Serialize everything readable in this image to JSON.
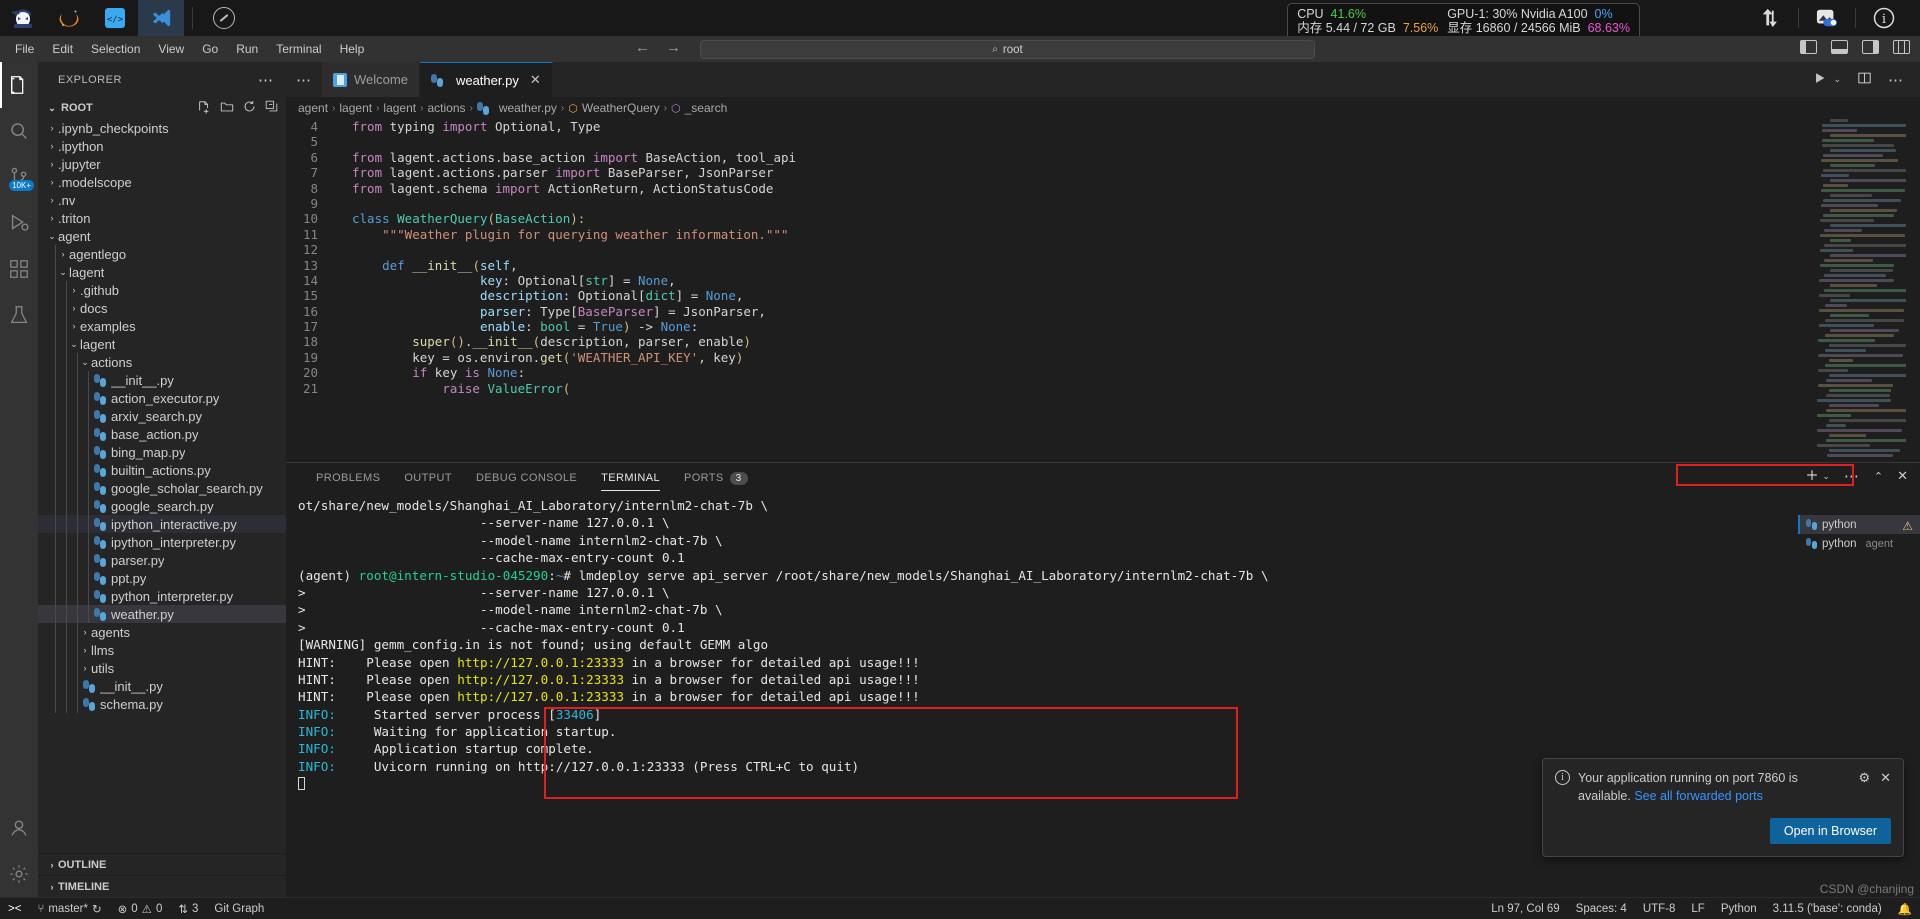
{
  "osbar": {
    "icons": [
      {
        "name": "ninja-app-icon",
        "glyph": "🥷"
      },
      {
        "name": "orange-crescent-icon",
        "glyph": "◠"
      },
      {
        "name": "code-brackets-icon",
        "glyph": "</>"
      },
      {
        "name": "vscode-icon",
        "glyph": "X"
      }
    ],
    "compass_label": "compass-icon",
    "sysmon": {
      "cpu_label": "CPU",
      "cpu_value": "41.6%",
      "mem_label": "内存",
      "mem_value": "5.44 / 72 GB",
      "mem_percent": "7.56%",
      "gpu_label": "GPU-1: 30% Nvidia A100",
      "gpu_value": "0%",
      "vram_label": "显存",
      "vram_value": "16860 / 24566 MiB",
      "vram_percent": "68.63%"
    }
  },
  "menubar": {
    "items": [
      "File",
      "Edit",
      "Selection",
      "View",
      "Go",
      "Run",
      "Terminal",
      "Help"
    ],
    "back_glyph": "←",
    "forward_glyph": "→",
    "search_text": "root",
    "search_icon": "⌕"
  },
  "activitybar": {
    "items": [
      {
        "name": "explorer",
        "glyph": "❐",
        "badge": ""
      },
      {
        "name": "search",
        "glyph": "⌕",
        "badge": ""
      },
      {
        "name": "source-control",
        "glyph": "⑂",
        "badge": "10K+"
      },
      {
        "name": "run-and-debug",
        "glyph": "▷",
        "badge": ""
      },
      {
        "name": "extensions",
        "glyph": "⧉",
        "badge": ""
      },
      {
        "name": "testing",
        "glyph": "⚗",
        "badge": ""
      }
    ],
    "bottom": [
      {
        "name": "accounts",
        "glyph": "☻"
      },
      {
        "name": "manage-settings",
        "glyph": "⚙"
      }
    ]
  },
  "sidebar": {
    "title": "EXPLORER",
    "more_glyph": "⋯",
    "root": {
      "label": "ROOT",
      "actions": [
        "new-file",
        "new-folder",
        "refresh",
        "collapse-all"
      ]
    },
    "tree": [
      {
        "label": ".ipynb_checkpoints",
        "type": "folder",
        "open": false,
        "depth": 1
      },
      {
        "label": ".ipython",
        "type": "folder",
        "open": false,
        "depth": 1
      },
      {
        "label": ".jupyter",
        "type": "folder",
        "open": false,
        "depth": 1
      },
      {
        "label": ".modelscope",
        "type": "folder",
        "open": false,
        "depth": 1
      },
      {
        "label": ".nv",
        "type": "folder",
        "open": false,
        "depth": 1
      },
      {
        "label": ".triton",
        "type": "folder",
        "open": false,
        "depth": 1
      },
      {
        "label": "agent",
        "type": "folder",
        "open": true,
        "depth": 1
      },
      {
        "label": "agentlego",
        "type": "folder",
        "open": false,
        "depth": 2
      },
      {
        "label": "lagent",
        "type": "folder",
        "open": true,
        "depth": 2
      },
      {
        "label": ".github",
        "type": "folder",
        "open": false,
        "depth": 3
      },
      {
        "label": "docs",
        "type": "folder",
        "open": false,
        "depth": 3
      },
      {
        "label": "examples",
        "type": "folder",
        "open": false,
        "depth": 3
      },
      {
        "label": "lagent",
        "type": "folder",
        "open": true,
        "depth": 3
      },
      {
        "label": "actions",
        "type": "folder",
        "open": true,
        "depth": 4
      },
      {
        "label": "__init__.py",
        "type": "py",
        "depth": 5
      },
      {
        "label": "action_executor.py",
        "type": "py",
        "depth": 5
      },
      {
        "label": "arxiv_search.py",
        "type": "py",
        "depth": 5
      },
      {
        "label": "base_action.py",
        "type": "py",
        "depth": 5
      },
      {
        "label": "bing_map.py",
        "type": "py",
        "depth": 5
      },
      {
        "label": "builtin_actions.py",
        "type": "py",
        "depth": 5
      },
      {
        "label": "google_scholar_search.py",
        "type": "py",
        "depth": 5
      },
      {
        "label": "google_search.py",
        "type": "py",
        "depth": 5
      },
      {
        "label": "ipython_interactive.py",
        "type": "py",
        "depth": 5,
        "hover": true
      },
      {
        "label": "ipython_interpreter.py",
        "type": "py",
        "depth": 5
      },
      {
        "label": "parser.py",
        "type": "py",
        "depth": 5
      },
      {
        "label": "ppt.py",
        "type": "py",
        "depth": 5
      },
      {
        "label": "python_interpreter.py",
        "type": "py",
        "depth": 5
      },
      {
        "label": "weather.py",
        "type": "py",
        "depth": 5,
        "selected": true
      },
      {
        "label": "agents",
        "type": "folder",
        "open": false,
        "depth": 4
      },
      {
        "label": "llms",
        "type": "folder",
        "open": false,
        "depth": 4
      },
      {
        "label": "utils",
        "type": "folder",
        "open": false,
        "depth": 4
      },
      {
        "label": "__init__.py",
        "type": "py",
        "depth": 4
      },
      {
        "label": "schema.py",
        "type": "py",
        "depth": 4
      }
    ],
    "footers": [
      {
        "label": "OUTLINE"
      },
      {
        "label": "TIMELINE"
      }
    ]
  },
  "editor": {
    "tabs": [
      {
        "label": "Welcome",
        "icon": "welcome-icon",
        "active": false
      },
      {
        "label": "weather.py",
        "icon": "python-icon",
        "active": true,
        "close": "✕"
      }
    ],
    "tab_actions": [
      "run-file",
      "split-editor",
      "more-actions"
    ],
    "breadcrumb": [
      "agent",
      "lagent",
      "lagent",
      "actions",
      "weather.py",
      "WeatherQuery",
      "_search"
    ],
    "lines": [
      {
        "n": 4,
        "tokens": [
          {
            "t": "from ",
            "c": "k-kw"
          },
          {
            "t": "typing ",
            "c": "k-plain"
          },
          {
            "t": "import ",
            "c": "k-kw"
          },
          {
            "t": "Optional, Type",
            "c": "k-plain"
          }
        ]
      },
      {
        "n": 5,
        "tokens": []
      },
      {
        "n": 6,
        "tokens": [
          {
            "t": "from ",
            "c": "k-kw"
          },
          {
            "t": "lagent.actions.base_action ",
            "c": "k-plain"
          },
          {
            "t": "import ",
            "c": "k-kw"
          },
          {
            "t": "BaseAction, tool_api",
            "c": "k-plain"
          }
        ]
      },
      {
        "n": 7,
        "tokens": [
          {
            "t": "from ",
            "c": "k-kw"
          },
          {
            "t": "lagent.actions.parser ",
            "c": "k-plain"
          },
          {
            "t": "import ",
            "c": "k-kw"
          },
          {
            "t": "BaseParser, JsonParser",
            "c": "k-plain"
          }
        ]
      },
      {
        "n": 8,
        "tokens": [
          {
            "t": "from ",
            "c": "k-kw"
          },
          {
            "t": "lagent.schema ",
            "c": "k-plain"
          },
          {
            "t": "import ",
            "c": "k-kw"
          },
          {
            "t": "ActionReturn, ActionStatusCode",
            "c": "k-plain"
          }
        ]
      },
      {
        "n": 9,
        "tokens": []
      },
      {
        "n": 10,
        "tokens": [
          {
            "t": "class ",
            "c": "k-ctl"
          },
          {
            "t": "WeatherQuery",
            "c": "k-cls"
          },
          {
            "t": "(",
            "c": "k-orange"
          },
          {
            "t": "BaseAction",
            "c": "k-cls"
          },
          {
            "t": "):",
            "c": "k-orange"
          }
        ]
      },
      {
        "n": 11,
        "tokens": [
          {
            "t": "    \"\"\"Weather plugin for querying weather information.\"\"\"",
            "c": "k-doc"
          }
        ]
      },
      {
        "n": 12,
        "tokens": []
      },
      {
        "n": 13,
        "tokens": [
          {
            "t": "    ",
            "c": "k-plain"
          },
          {
            "t": "def ",
            "c": "k-ctl"
          },
          {
            "t": "__init__",
            "c": "k-fn"
          },
          {
            "t": "(",
            "c": "k-orange"
          },
          {
            "t": "self",
            "c": "k-var"
          },
          {
            "t": ",",
            "c": "k-plain"
          }
        ]
      },
      {
        "n": 14,
        "tokens": [
          {
            "t": "                 ",
            "c": "k-plain"
          },
          {
            "t": "key",
            "c": "k-var"
          },
          {
            "t": ": Optional[",
            "c": "k-plain"
          },
          {
            "t": "str",
            "c": "k-cls"
          },
          {
            "t": "] = ",
            "c": "k-plain"
          },
          {
            "t": "None",
            "c": "k-ctl"
          },
          {
            "t": ",",
            "c": "k-plain"
          }
        ]
      },
      {
        "n": 15,
        "tokens": [
          {
            "t": "                 ",
            "c": "k-plain"
          },
          {
            "t": "description",
            "c": "k-var"
          },
          {
            "t": ": Optional[",
            "c": "k-plain"
          },
          {
            "t": "dict",
            "c": "k-cls"
          },
          {
            "t": "] = ",
            "c": "k-plain"
          },
          {
            "t": "None",
            "c": "k-ctl"
          },
          {
            "t": ",",
            "c": "k-plain"
          }
        ]
      },
      {
        "n": 16,
        "tokens": [
          {
            "t": "                 ",
            "c": "k-plain"
          },
          {
            "t": "parser",
            "c": "k-var"
          },
          {
            "t": ": Type[",
            "c": "k-plain"
          },
          {
            "t": "BaseParser",
            "c": "k-pink"
          },
          {
            "t": "] = JsonParser,",
            "c": "k-plain"
          }
        ]
      },
      {
        "n": 17,
        "tokens": [
          {
            "t": "                 ",
            "c": "k-plain"
          },
          {
            "t": "enable",
            "c": "k-var"
          },
          {
            "t": ": ",
            "c": "k-plain"
          },
          {
            "t": "bool",
            "c": "k-cls"
          },
          {
            "t": " = ",
            "c": "k-plain"
          },
          {
            "t": "True",
            "c": "k-ctl"
          },
          {
            "t": ")",
            "c": "k-orange"
          },
          {
            "t": " -> ",
            "c": "k-plain"
          },
          {
            "t": "None",
            "c": "k-ctl"
          },
          {
            "t": ":",
            "c": "k-plain"
          }
        ]
      },
      {
        "n": 18,
        "tokens": [
          {
            "t": "        ",
            "c": "k-plain"
          },
          {
            "t": "super",
            "c": "k-fn"
          },
          {
            "t": "()",
            "c": "k-orange"
          },
          {
            "t": ".",
            "c": "k-plain"
          },
          {
            "t": "__init__",
            "c": "k-fn"
          },
          {
            "t": "(",
            "c": "k-orange"
          },
          {
            "t": "description, parser, enable",
            "c": "k-plain"
          },
          {
            "t": ")",
            "c": "k-orange"
          }
        ]
      },
      {
        "n": 19,
        "tokens": [
          {
            "t": "        key = os.environ.",
            "c": "k-plain"
          },
          {
            "t": "get",
            "c": "k-fn"
          },
          {
            "t": "(",
            "c": "k-orange"
          },
          {
            "t": "'WEATHER_API_KEY'",
            "c": "k-str"
          },
          {
            "t": ", key",
            "c": "k-plain"
          },
          {
            "t": ")",
            "c": "k-orange"
          }
        ]
      },
      {
        "n": 20,
        "tokens": [
          {
            "t": "        ",
            "c": "k-plain"
          },
          {
            "t": "if ",
            "c": "k-pink"
          },
          {
            "t": "key ",
            "c": "k-plain"
          },
          {
            "t": "is ",
            "c": "k-pink"
          },
          {
            "t": "None",
            "c": "k-ctl"
          },
          {
            "t": ":",
            "c": "k-plain"
          }
        ]
      },
      {
        "n": 21,
        "tokens": [
          {
            "t": "            ",
            "c": "k-plain"
          },
          {
            "t": "raise ",
            "c": "k-pink"
          },
          {
            "t": "ValueError",
            "c": "k-cls"
          },
          {
            "t": "(",
            "c": "k-orange"
          }
        ]
      }
    ]
  },
  "panel": {
    "tabs": [
      {
        "label": "PROBLEMS",
        "active": false
      },
      {
        "label": "OUTPUT",
        "active": false
      },
      {
        "label": "DEBUG CONSOLE",
        "active": false
      },
      {
        "label": "TERMINAL",
        "active": true
      },
      {
        "label": "PORTS",
        "active": false,
        "badge": "3"
      }
    ],
    "actions": [
      "new-terminal",
      "terminal-dropdown",
      "more-actions",
      "maximize-panel",
      "close-panel"
    ],
    "terminal_lines": [
      {
        "segs": [
          {
            "t": "ot/share/new_models/Shanghai_AI_Laboratory/internlm2-chat-7b \\",
            "c": "t-white"
          }
        ]
      },
      {
        "segs": [
          {
            "t": "                        --server-name 127.0.0.1 \\",
            "c": "t-white"
          }
        ]
      },
      {
        "segs": [
          {
            "t": "                        --model-name internlm2-chat-7b \\",
            "c": "t-white"
          }
        ]
      },
      {
        "segs": [
          {
            "t": "                        --cache-max-entry-count 0.1",
            "c": "t-white"
          }
        ]
      },
      {
        "segs": [
          {
            "t": "(agent) ",
            "c": "t-white"
          },
          {
            "t": "root@intern-studio-045290",
            "c": "t-green"
          },
          {
            "t": ":",
            "c": "t-white"
          },
          {
            "t": "~",
            "c": "t-blue"
          },
          {
            "t": "# lmdeploy serve api_server /root/share/new_models/Shanghai_AI_Laboratory/internlm2-chat-7b \\",
            "c": "t-white"
          }
        ]
      },
      {
        "segs": [
          {
            "t": ">                       --server-name 127.0.0.1 \\",
            "c": "t-white"
          }
        ]
      },
      {
        "segs": [
          {
            "t": ">                       --model-name internlm2-chat-7b \\",
            "c": "t-white"
          }
        ]
      },
      {
        "segs": [
          {
            "t": ">                       --cache-max-entry-count 0.1",
            "c": "t-white"
          }
        ]
      },
      {
        "segs": [
          {
            "t": "[WARNING] gemm_config.in is not found; using default GEMM algo",
            "c": "t-white"
          }
        ]
      },
      {
        "segs": [
          {
            "t": "HINT:    Please open ",
            "c": "t-white"
          },
          {
            "t": "http://127.0.0.1:23333",
            "c": "t-yellow"
          },
          {
            "t": " in a browser for detailed api usage!!!",
            "c": "t-white"
          }
        ]
      },
      {
        "segs": [
          {
            "t": "HINT:    Please open ",
            "c": "t-white"
          },
          {
            "t": "http://127.0.0.1:23333",
            "c": "t-yellow"
          },
          {
            "t": " in a browser for detailed api usage!!!",
            "c": "t-white"
          }
        ]
      },
      {
        "segs": [
          {
            "t": "HINT:    Please open ",
            "c": "t-white"
          },
          {
            "t": "http://127.0.0.1:23333",
            "c": "t-yellow"
          },
          {
            "t": " in a browser for detailed api usage!!!",
            "c": "t-white"
          }
        ]
      },
      {
        "segs": [
          {
            "t": "INFO:",
            "c": "t-cyan"
          },
          {
            "t": "     Started server process [",
            "c": "t-white"
          },
          {
            "t": "33406",
            "c": "t-cyan"
          },
          {
            "t": "]",
            "c": "t-white"
          }
        ]
      },
      {
        "segs": [
          {
            "t": "INFO:",
            "c": "t-cyan"
          },
          {
            "t": "     Waiting for application startup.",
            "c": "t-white"
          }
        ]
      },
      {
        "segs": [
          {
            "t": "INFO:",
            "c": "t-cyan"
          },
          {
            "t": "     Application startup complete.",
            "c": "t-white"
          }
        ]
      },
      {
        "segs": [
          {
            "t": "INFO:",
            "c": "t-cyan"
          },
          {
            "t": "     Uvicorn running on ",
            "c": "t-white"
          },
          {
            "t": "http://127.0.0.1:23333",
            "c": "t-white"
          },
          {
            "t": " (Press CTRL+C to quit)",
            "c": "t-white"
          }
        ]
      }
    ],
    "terminal_list": [
      {
        "label": "python",
        "sub": "",
        "selected": true
      },
      {
        "label": "python",
        "sub": "agent",
        "selected": false
      }
    ]
  },
  "toast": {
    "message_prefix": "Your application running on port 7860 is available.",
    "see_all_link": "See all",
    "forwarded_ports_link": "forwarded ports",
    "gear_glyph": "⚙",
    "close_glyph": "✕",
    "button_label": "Open in Browser"
  },
  "statusbar": {
    "remote_glyph": "><",
    "branch": "master*",
    "sync_glyph": "↻",
    "errors": "0",
    "warnings": "0",
    "info": "3",
    "git_graph": "Git Graph",
    "position": "Ln 97, Col 69",
    "spaces": "Spaces: 4",
    "encoding": "UTF-8",
    "eol": "LF",
    "language": "Python",
    "interpreter": "3.11.5 ('base': conda)",
    "bell_glyph": "🔔"
  },
  "watermark": "CSDN @chanjing"
}
